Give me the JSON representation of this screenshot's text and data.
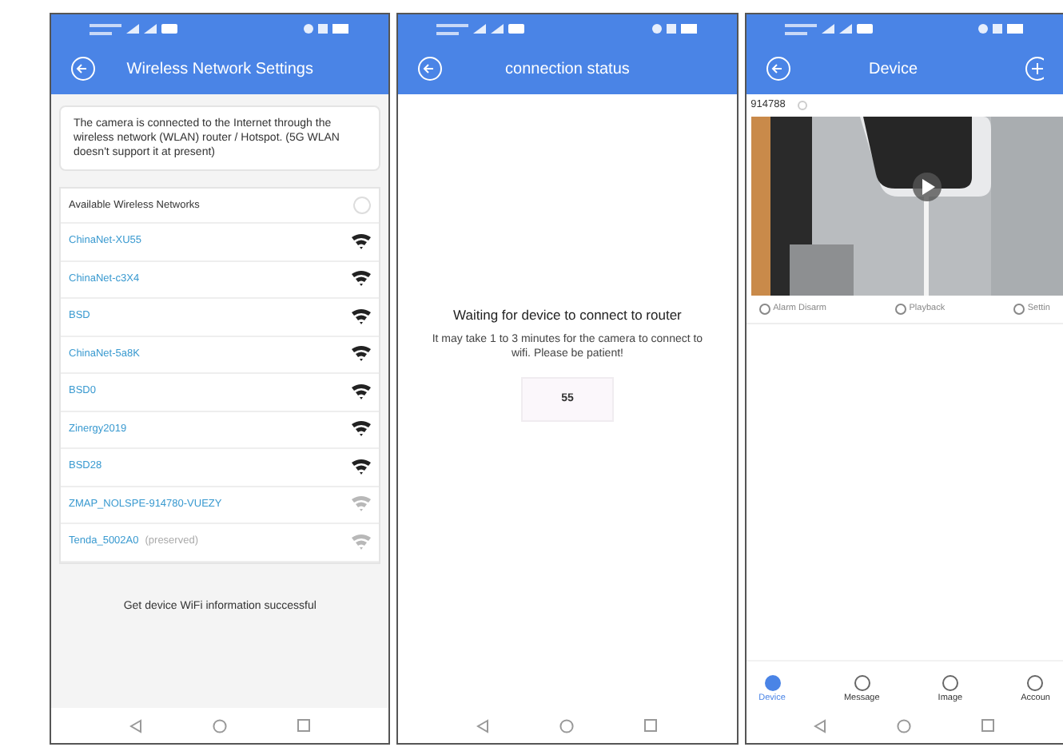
{
  "wifi_screen": {
    "title": "Wireless Network Settings",
    "notice": "The camera is connected to the Internet through the wireless network (WLAN) router / Hotspot. (5G WLAN doesn't support it at present)",
    "list_header": "Available Wireless Networks",
    "networks": [
      {
        "name": "ChinaNet-XU55",
        "weak": false
      },
      {
        "name": "ChinaNet-c3X4",
        "weak": false
      },
      {
        "name": "BSD",
        "weak": false
      },
      {
        "name": "ChinaNet-5a8K",
        "weak": false
      },
      {
        "name": "BSD0",
        "weak": false
      },
      {
        "name": "Zinergy2019",
        "weak": false
      },
      {
        "name": "BSD28",
        "weak": false
      },
      {
        "name": "ZMAP_NOLSPE-914780-VUEZY",
        "weak": true
      },
      {
        "name": "Tenda_5002A0",
        "note": "(preserved)",
        "weak": true
      }
    ],
    "message": "Get device WiFi information successful"
  },
  "status_screen": {
    "title": "connection status",
    "heading": "Waiting for device to connect to router",
    "hint": "It may take 1 to 3 minutes for the camera to connect to wifi. Please be patient!",
    "countdown": "55"
  },
  "device_screen": {
    "title": "Device",
    "device_id": "914788",
    "actions": [
      "Alarm Disarm",
      "Playback",
      "Settin"
    ],
    "tabs": [
      {
        "label": "Device",
        "selected": true
      },
      {
        "label": "Message",
        "selected": false
      },
      {
        "label": "Image",
        "selected": false
      },
      {
        "label": "Accoun",
        "selected": false
      }
    ]
  }
}
